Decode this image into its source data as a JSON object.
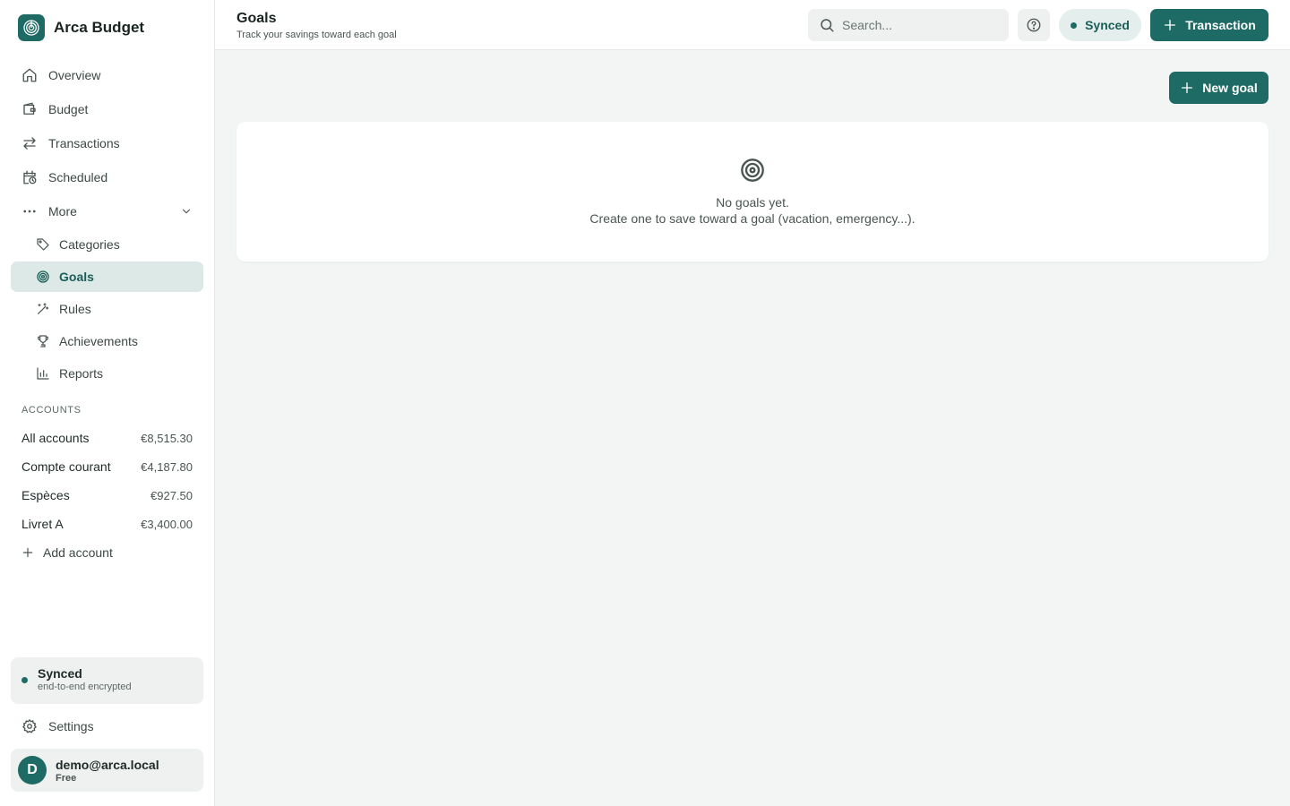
{
  "app": {
    "name": "Arca Budget"
  },
  "nav": {
    "items": [
      {
        "label": "Overview",
        "icon": "home-icon"
      },
      {
        "label": "Budget",
        "icon": "wallet-icon"
      },
      {
        "label": "Transactions",
        "icon": "arrows-swap-icon"
      },
      {
        "label": "Scheduled",
        "icon": "calendar-clock-icon"
      },
      {
        "label": "More",
        "icon": "more-dots-icon"
      }
    ],
    "sub_items": [
      {
        "label": "Categories",
        "icon": "tag-icon"
      },
      {
        "label": "Goals",
        "icon": "target-icon",
        "active": true
      },
      {
        "label": "Rules",
        "icon": "magic-wand-icon"
      },
      {
        "label": "Achievements",
        "icon": "trophy-icon"
      },
      {
        "label": "Reports",
        "icon": "bar-chart-icon"
      }
    ]
  },
  "accounts": {
    "heading": "ACCOUNTS",
    "items": [
      {
        "name": "All accounts",
        "balance": "€8,515.30"
      },
      {
        "name": "Compte courant",
        "balance": "€4,187.80"
      },
      {
        "name": "Espèces",
        "balance": "€927.50"
      },
      {
        "name": "Livret A",
        "balance": "€3,400.00"
      }
    ],
    "add_label": "Add account"
  },
  "sync_card": {
    "title": "Synced",
    "subtitle": "end-to-end encrypted"
  },
  "settings_label": "Settings",
  "user": {
    "initial": "D",
    "email": "demo@arca.local",
    "plan": "Free"
  },
  "header": {
    "title": "Goals",
    "subtitle": "Track your savings toward each goal",
    "search_placeholder": "Search...",
    "sync_status": "Synced",
    "transaction_button": "Transaction"
  },
  "main": {
    "new_goal_button": "New goal",
    "empty_title": "No goals yet.",
    "empty_description": "Create one to save toward a goal (vacation, emergency...)."
  },
  "colors": {
    "accent": "#1d6b64",
    "active_bg": "#dde9e7",
    "background": "#f3f5f4"
  }
}
